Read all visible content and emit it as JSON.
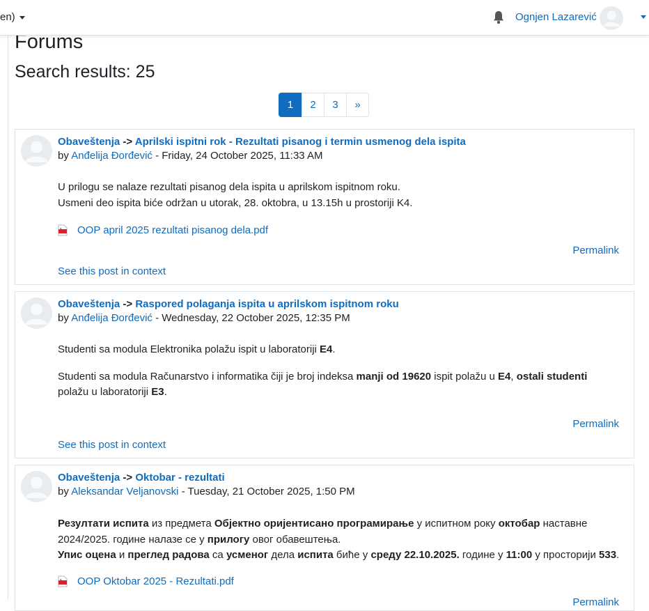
{
  "topbar": {
    "language_label": "en)",
    "user_name": "Ognjen Lazarević"
  },
  "page": {
    "title": "Forums",
    "results_label": "Search results: 25"
  },
  "pagination": {
    "pages": [
      "1",
      "2",
      "3"
    ],
    "next": "»",
    "active_page": "1"
  },
  "posts": [
    {
      "forum": "Obaveštenja",
      "arrow": "->",
      "title": "Aprilski ispitni rok - Rezultati pisanog i termin usmenog dela ispita",
      "by": "by",
      "author": "Anđelija Đorđević",
      "date": " - Friday, 24 October 2025, 11:33 AM",
      "lines": [
        "U prilogu se nalaze rezultati pisanog dela ispita u aprilskom ispitnom roku.",
        "Usmeni deo ispita biće održan u utorak, 28. oktobra, u 13.15h u prostoriji K4."
      ],
      "attachment": "OOP april 2025 rezultati pisanog dela.pdf",
      "permalink": "Permalink",
      "context": "See this post in context"
    },
    {
      "forum": "Obaveštenja",
      "arrow": "->",
      "title": "Raspored polaganja ispita u aprilskom ispitnom roku",
      "by": "by",
      "author": "Anđelija Đorđević",
      "date": " - Wednesday, 22 October 2025, 12:35 PM",
      "p1": {
        "a": "Studenti sa modula Elektronika polažu ispit u laboratoriji ",
        "b": "E4",
        "c": "."
      },
      "p2": {
        "a": "Studenti sa modula Računarstvo i informatika čiji je broj indeksa ",
        "b": "manji od 19620",
        "c": " ispit polažu u ",
        "d": "E4",
        "e": ", ",
        "f": "ostali studenti",
        "g": " polažu u laboratoriji ",
        "h": "E3",
        "i": "."
      },
      "permalink": "Permalink",
      "context": "See this post in context"
    },
    {
      "forum": "Obaveštenja",
      "arrow": "->",
      "title": "Oktobar - rezultati",
      "by": "by",
      "author": "Aleksandar Veljanovski",
      "date": " - Tuesday, 21 October 2025, 1:50 PM",
      "l1": {
        "a": "Резултати испита",
        "b": " из предмета ",
        "c": "Објектно оријентисано програмирање",
        "d": " у испитном року ",
        "e": "октобар",
        "f": " наставне 2024/2025. године налазе се у ",
        "g": "прилогу",
        "h": " овог обавештења."
      },
      "l2": {
        "a": "Упис оцена",
        "b": " и ",
        "c": "преглед радова",
        "d": " са ",
        "e": "усменог",
        "f": " дела ",
        "g": "испита",
        "h": " биће у ",
        "i": "среду 22.10.2025.",
        "j": " године у ",
        "k": "11:00",
        "l": " у просторији ",
        "m": "533",
        "n": "."
      },
      "attachment": "OOP Oktobar 2025 - Rezultati.pdf",
      "permalink": "Permalink"
    }
  ],
  "colors": {
    "link": "#0f6cbf",
    "text": "#1d2125",
    "pdf_icon": "#d9232d"
  }
}
